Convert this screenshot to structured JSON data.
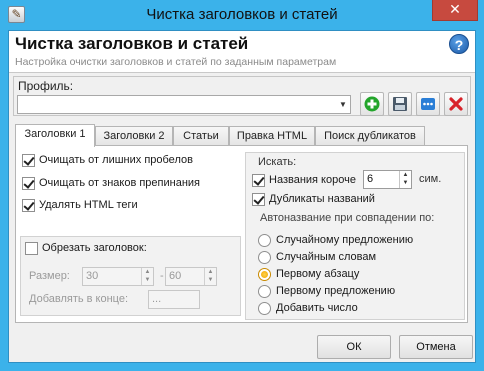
{
  "window": {
    "title": "Чистка заголовков и статей",
    "close_glyph": "✕",
    "app_icon": "app-icon"
  },
  "header": {
    "title": "Чистка заголовков и статей",
    "subtitle": "Настройка очистки заголовков и статей по заданным параметрам",
    "help_glyph": "?"
  },
  "profile": {
    "label": "Профиль:",
    "value": "",
    "buttons": [
      {
        "name": "add-profile-button",
        "icon": "plus-icon",
        "color": "#23a52b"
      },
      {
        "name": "save-profile-button",
        "icon": "floppy-icon",
        "color": "#4a5a6a"
      },
      {
        "name": "rename-profile-button",
        "icon": "dots-icon",
        "color": "#2a7ed6"
      },
      {
        "name": "delete-profile-button",
        "icon": "x-icon",
        "color": "#d8232a"
      }
    ]
  },
  "tabs": [
    {
      "label": "Заголовки 1",
      "active": true
    },
    {
      "label": "Заголовки 2",
      "active": false
    },
    {
      "label": "Статьи",
      "active": false
    },
    {
      "label": "Правка HTML",
      "active": false
    },
    {
      "label": "Поиск дубликатов",
      "active": false
    }
  ],
  "options": [
    {
      "label": "Очищать от лишних пробелов",
      "checked": true
    },
    {
      "label": "Очищать от знаков препинания",
      "checked": true
    },
    {
      "label": "Удалять HTML теги",
      "checked": true
    }
  ],
  "trim": {
    "label": "Обрезать заголовок:",
    "checked": false,
    "size_label": "Размер:",
    "size_from": "30",
    "size_dash": "-",
    "size_to": "60",
    "suffix_label": "Добавлять в конце:",
    "suffix_value": "..."
  },
  "search": {
    "title": "Искать:",
    "short_titles_label": "Названия короче",
    "short_titles_checked": true,
    "short_titles_value": "6",
    "short_titles_unit": "сим.",
    "duplicates_label": "Дубликаты названий",
    "duplicates_checked": true,
    "autoname_label": "Автоназвание при совпадении по:",
    "radios": [
      {
        "label": "Случайному предложению",
        "selected": false
      },
      {
        "label": "Случайным словам",
        "selected": false
      },
      {
        "label": "Первому абзацу",
        "selected": true
      },
      {
        "label": "Первому предложению",
        "selected": false
      },
      {
        "label": "Добавить число",
        "selected": false
      }
    ]
  },
  "footer": {
    "ok_label": "ОК",
    "cancel_label": "Отмена"
  }
}
